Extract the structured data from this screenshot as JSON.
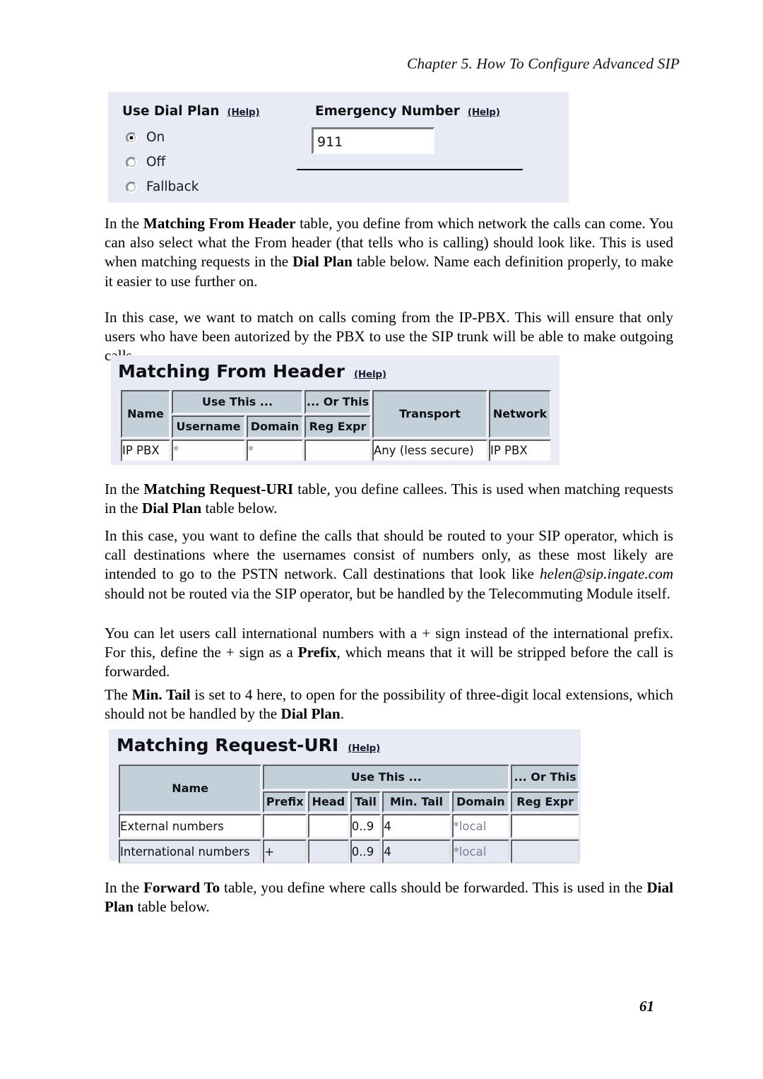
{
  "page": {
    "running_head": "Chapter 5. How To Configure Advanced SIP",
    "page_number": "61"
  },
  "dial_plan_panel": {
    "use_dial_plan_label": "Use Dial Plan",
    "use_dial_plan_help": "(Help)",
    "options": [
      {
        "label": "On",
        "selected": true
      },
      {
        "label": "Off",
        "selected": false
      },
      {
        "label": "Fallback",
        "selected": false
      }
    ],
    "emergency_number_label": "Emergency Number",
    "emergency_number_help": "(Help)",
    "emergency_number_value": "911"
  },
  "paragraphs": {
    "p1_pre": "In the ",
    "p1_b1": "Matching From Header",
    "p1_mid": " table, you define from which network the calls can come. You can also select what the From header (that tells who is calling) should look like. This is used when matching requests in the ",
    "p1_b2": "Dial Plan",
    "p1_post": " table below. Name each definition properly, to make it easier to use further on.",
    "p2": "In this case, we want to match on calls coming from the IP-PBX. This will ensure that only users who have been autorized by the PBX to use the SIP trunk will be able to make outgoing calls.",
    "p3_pre": "In the ",
    "p3_b1": "Matching Request-URI",
    "p3_mid": " table, you define callees. This is used when matching requests in the ",
    "p3_b2": "Dial Plan",
    "p3_post": " table below.",
    "p4_pre": "In this case, you want to define the calls that should be routed to your SIP operator, which is call destinations where the usernames consist of numbers only, as these most likely are intended to go to the PSTN network. Call destinations that look like ",
    "p4_i1": "helen@sip.ingate.com",
    "p4_post": " should not be routed via the SIP operator, but be handled by the Telecommuting Module itself.",
    "p5_pre": "You can let users call international numbers with a + sign instead of the international prefix. For this, define the + sign as a ",
    "p5_b1": "Prefix",
    "p5_post": ", which means that it will be stripped before the call is forwarded.",
    "p6_pre": "The ",
    "p6_b1": "Min. Tail",
    "p6_mid": " is set to 4 here, to open for the possibility of three-digit local extensions, which should not be handled by the ",
    "p6_b2": "Dial Plan",
    "p6_post": ".",
    "p7_pre": "In the ",
    "p7_b1": "Forward To",
    "p7_mid": " table, you define where calls should be forwarded. This is used in the ",
    "p7_b2": "Dial Plan",
    "p7_post": " table below."
  },
  "matching_from_header": {
    "title": "Matching From Header",
    "help": "(Help)",
    "group_headers": {
      "name": "Name",
      "use_this": "Use This ...",
      "or_this": "... Or This",
      "transport": "Transport",
      "network": "Network"
    },
    "sub_headers": {
      "username": "Username",
      "domain": "Domain",
      "reg_expr": "Reg Expr"
    },
    "rows": [
      {
        "name": "IP PBX",
        "username": "*",
        "domain": "*",
        "reg_expr": "",
        "transport": "Any (less secure)",
        "network": "IP PBX"
      }
    ]
  },
  "matching_request_uri": {
    "title": "Matching Request-URI",
    "help": "(Help)",
    "group_headers": {
      "name": "Name",
      "use_this": "Use This ...",
      "or_this": "... Or This"
    },
    "sub_headers": {
      "prefix": "Prefix",
      "head": "Head",
      "tail": "Tail",
      "min_tail": "Min. Tail",
      "domain": "Domain",
      "reg_expr": "Reg Expr"
    },
    "rows": [
      {
        "name": "External numbers",
        "prefix": "",
        "head": "",
        "tail": "0..9",
        "min_tail": "4",
        "domain": "*local",
        "reg_expr": ""
      },
      {
        "name": "International numbers",
        "prefix": "+",
        "head": "",
        "tail": "0..9",
        "min_tail": "4",
        "domain": "*local",
        "reg_expr": ""
      }
    ]
  },
  "colors": {
    "panel_background": "#e8eaf6",
    "table_header": "#c3cfd9",
    "alt_row": "#e3e8f3",
    "page_background": "#ffffff"
  }
}
